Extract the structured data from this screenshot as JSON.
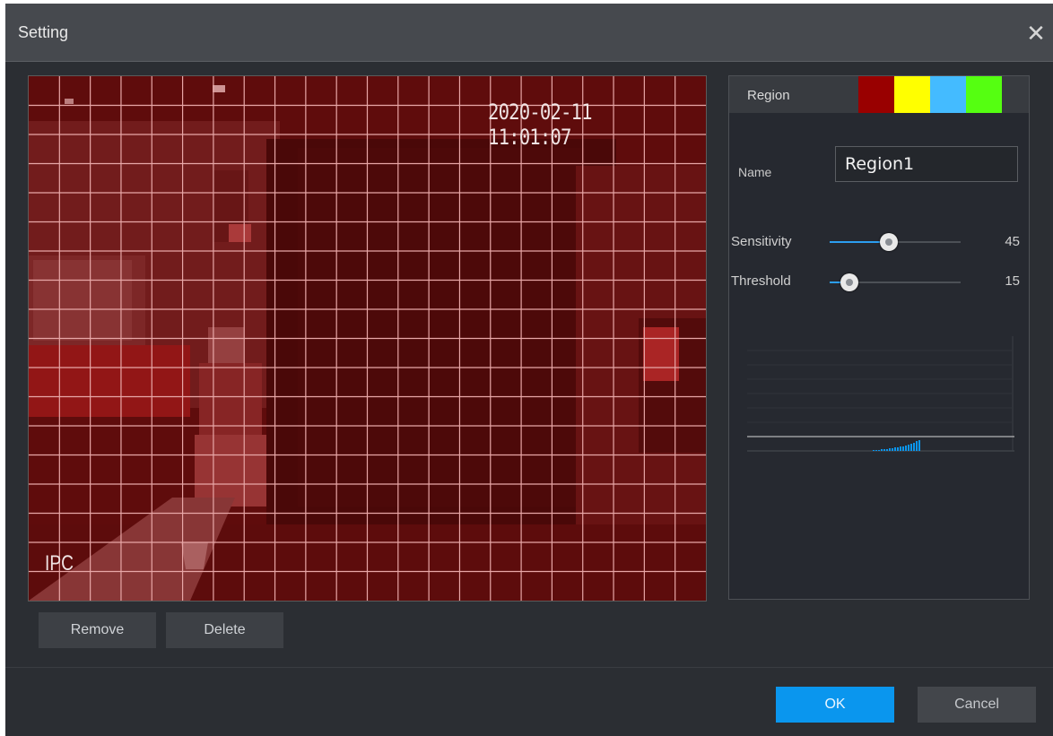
{
  "dialog": {
    "title": "Setting",
    "close_icon": "close-icon"
  },
  "video": {
    "timestamp": "2020-02-11 11:01:07",
    "camera_label": "IPC",
    "overlay_color": "#a01010"
  },
  "buttons": {
    "remove": "Remove",
    "delete": "Delete",
    "ok": "OK",
    "cancel": "Cancel"
  },
  "panel": {
    "region_label": "Region",
    "region_colors": [
      "#990000",
      "#ffff00",
      "#44bbff",
      "#55ff11"
    ],
    "name_label": "Name",
    "name_value": "Region1",
    "sensitivity": {
      "label": "Sensitivity",
      "value": 45,
      "display": "45"
    },
    "threshold": {
      "label": "Threshold",
      "value": 15,
      "display": "15"
    }
  },
  "accent_color": "#0a96ee"
}
